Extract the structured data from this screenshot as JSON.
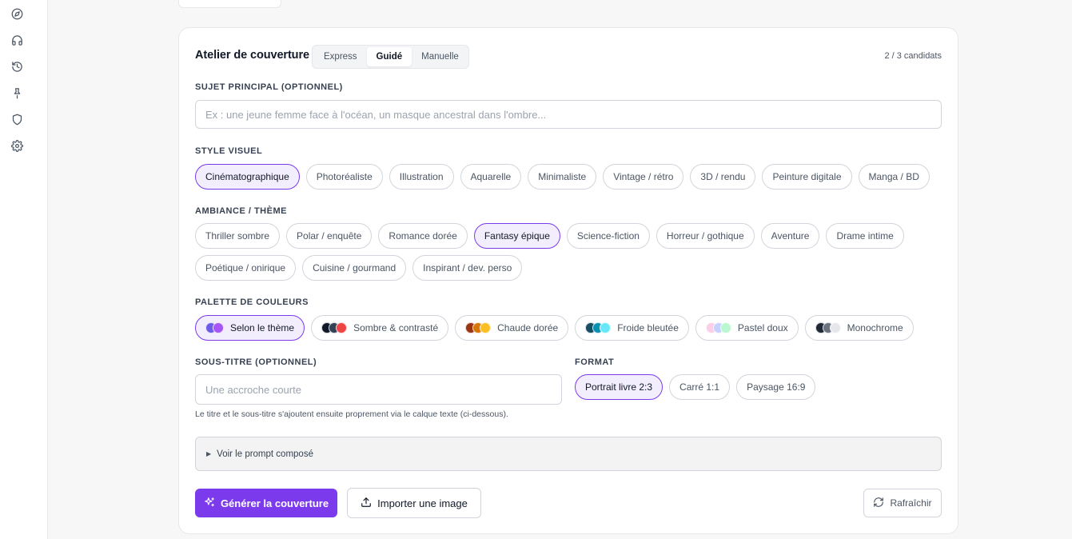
{
  "sidebar": {
    "icons": [
      "compass-icon",
      "headphones-icon",
      "history-icon",
      "pin-icon",
      "shield-icon",
      "gear-icon"
    ]
  },
  "workshop": {
    "title": "Atelier de couverture",
    "modes": [
      "Express",
      "Guidé",
      "Manuelle"
    ],
    "active_mode": "Guidé",
    "candidates": "2 / 3 candidats"
  },
  "subject": {
    "label": "SUJET PRINCIPAL (OPTIONNEL)",
    "placeholder": "Ex : une jeune femme face à l'océan, un masque ancestral dans l'ombre...",
    "value": ""
  },
  "style": {
    "label": "STYLE VISUEL",
    "options": [
      "Cinématographique",
      "Photoréaliste",
      "Illustration",
      "Aquarelle",
      "Minimaliste",
      "Vintage / rétro",
      "3D / rendu",
      "Peinture digitale",
      "Manga / BD"
    ],
    "selected": "Cinématographique"
  },
  "mood": {
    "label": "AMBIANCE / THÈME",
    "options": [
      "Thriller sombre",
      "Polar / enquête",
      "Romance dorée",
      "Fantasy épique",
      "Science-fiction",
      "Horreur / gothique",
      "Aventure",
      "Drame intime",
      "Poétique / onirique",
      "Cuisine / gourmand",
      "Inspirant / dev. perso"
    ],
    "selected": "Fantasy épique"
  },
  "palette": {
    "label": "PALETTE DE COULEURS",
    "options": [
      {
        "label": "Selon le thème",
        "colors": [
          "#6d5ce8",
          "#a855f7"
        ]
      },
      {
        "label": "Sombre & contrasté",
        "colors": [
          "#111827",
          "#334155",
          "#ef4444"
        ]
      },
      {
        "label": "Chaude dorée",
        "colors": [
          "#9a3412",
          "#d97706",
          "#fbbf24"
        ]
      },
      {
        "label": "Froide bleutée",
        "colors": [
          "#164e63",
          "#0891b2",
          "#67e8f9"
        ]
      },
      {
        "label": "Pastel doux",
        "colors": [
          "#fbcfe8",
          "#c7d2fe",
          "#bbf7d0"
        ]
      },
      {
        "label": "Monochrome",
        "colors": [
          "#1f2937",
          "#6b7280",
          "#e5e7eb"
        ]
      }
    ],
    "selected": "Selon le thème"
  },
  "subtitle": {
    "label": "SOUS-TITRE (OPTIONNEL)",
    "placeholder": "Une accroche courte",
    "value": "",
    "help": "Le titre et le sous-titre s'ajoutent ensuite proprement via le calque texte (ci-dessous)."
  },
  "format": {
    "label": "FORMAT",
    "options": [
      "Portrait livre 2:3",
      "Carré 1:1",
      "Paysage 16:9"
    ],
    "selected": "Portrait livre 2:3"
  },
  "prompt_toggle": "Voir le prompt composé",
  "actions": {
    "generate": "Générer la couverture",
    "import": "Importer une image",
    "refresh": "Rafraîchir"
  },
  "colors": {
    "accent": "#7c3aed",
    "accent_soft": "#f3eefe"
  }
}
